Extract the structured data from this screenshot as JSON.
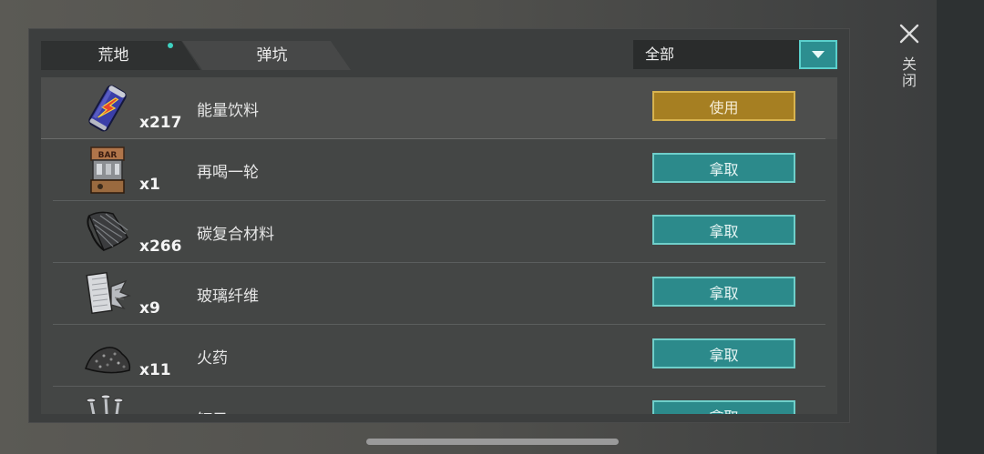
{
  "tabs": [
    {
      "label": "荒地",
      "active": true
    },
    {
      "label": "弹坑",
      "active": false
    }
  ],
  "filter": {
    "selected": "全部"
  },
  "close": {
    "label": "关闭"
  },
  "items": [
    {
      "name": "能量饮料",
      "qty": "x217",
      "action": "使用",
      "icon": "energy-drink-can-icon"
    },
    {
      "name": "再喝一轮",
      "qty": "x1",
      "action": "拿取",
      "icon": "bar-counter-icon"
    },
    {
      "name": "碳复合材料",
      "qty": "x266",
      "action": "拿取",
      "icon": "carbon-composite-sheet-icon"
    },
    {
      "name": "玻璃纤维",
      "qty": "x9",
      "action": "拿取",
      "icon": "fiberglass-icon"
    },
    {
      "name": "火药",
      "qty": "x11",
      "action": "拿取",
      "icon": "gunpowder-pile-icon"
    },
    {
      "name": "钉子",
      "qty": "",
      "action": "拿取",
      "icon": "nails-icon"
    }
  ],
  "colors": {
    "accent": "#2c8a8b",
    "use_button": "#a67f22",
    "tab_dot": "#3ed1c1"
  }
}
